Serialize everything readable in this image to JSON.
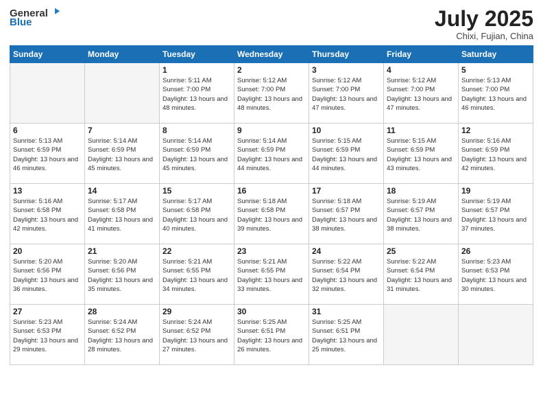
{
  "header": {
    "logo_general": "General",
    "logo_blue": "Blue",
    "month": "July 2025",
    "location": "Chixi, Fujian, China"
  },
  "weekdays": [
    "Sunday",
    "Monday",
    "Tuesday",
    "Wednesday",
    "Thursday",
    "Friday",
    "Saturday"
  ],
  "weeks": [
    [
      {
        "day": "",
        "info": ""
      },
      {
        "day": "",
        "info": ""
      },
      {
        "day": "1",
        "info": "Sunrise: 5:11 AM\nSunset: 7:00 PM\nDaylight: 13 hours and 48 minutes."
      },
      {
        "day": "2",
        "info": "Sunrise: 5:12 AM\nSunset: 7:00 PM\nDaylight: 13 hours and 48 minutes."
      },
      {
        "day": "3",
        "info": "Sunrise: 5:12 AM\nSunset: 7:00 PM\nDaylight: 13 hours and 47 minutes."
      },
      {
        "day": "4",
        "info": "Sunrise: 5:12 AM\nSunset: 7:00 PM\nDaylight: 13 hours and 47 minutes."
      },
      {
        "day": "5",
        "info": "Sunrise: 5:13 AM\nSunset: 7:00 PM\nDaylight: 13 hours and 46 minutes."
      }
    ],
    [
      {
        "day": "6",
        "info": "Sunrise: 5:13 AM\nSunset: 6:59 PM\nDaylight: 13 hours and 46 minutes."
      },
      {
        "day": "7",
        "info": "Sunrise: 5:14 AM\nSunset: 6:59 PM\nDaylight: 13 hours and 45 minutes."
      },
      {
        "day": "8",
        "info": "Sunrise: 5:14 AM\nSunset: 6:59 PM\nDaylight: 13 hours and 45 minutes."
      },
      {
        "day": "9",
        "info": "Sunrise: 5:14 AM\nSunset: 6:59 PM\nDaylight: 13 hours and 44 minutes."
      },
      {
        "day": "10",
        "info": "Sunrise: 5:15 AM\nSunset: 6:59 PM\nDaylight: 13 hours and 44 minutes."
      },
      {
        "day": "11",
        "info": "Sunrise: 5:15 AM\nSunset: 6:59 PM\nDaylight: 13 hours and 43 minutes."
      },
      {
        "day": "12",
        "info": "Sunrise: 5:16 AM\nSunset: 6:59 PM\nDaylight: 13 hours and 42 minutes."
      }
    ],
    [
      {
        "day": "13",
        "info": "Sunrise: 5:16 AM\nSunset: 6:58 PM\nDaylight: 13 hours and 42 minutes."
      },
      {
        "day": "14",
        "info": "Sunrise: 5:17 AM\nSunset: 6:58 PM\nDaylight: 13 hours and 41 minutes."
      },
      {
        "day": "15",
        "info": "Sunrise: 5:17 AM\nSunset: 6:58 PM\nDaylight: 13 hours and 40 minutes."
      },
      {
        "day": "16",
        "info": "Sunrise: 5:18 AM\nSunset: 6:58 PM\nDaylight: 13 hours and 39 minutes."
      },
      {
        "day": "17",
        "info": "Sunrise: 5:18 AM\nSunset: 6:57 PM\nDaylight: 13 hours and 38 minutes."
      },
      {
        "day": "18",
        "info": "Sunrise: 5:19 AM\nSunset: 6:57 PM\nDaylight: 13 hours and 38 minutes."
      },
      {
        "day": "19",
        "info": "Sunrise: 5:19 AM\nSunset: 6:57 PM\nDaylight: 13 hours and 37 minutes."
      }
    ],
    [
      {
        "day": "20",
        "info": "Sunrise: 5:20 AM\nSunset: 6:56 PM\nDaylight: 13 hours and 36 minutes."
      },
      {
        "day": "21",
        "info": "Sunrise: 5:20 AM\nSunset: 6:56 PM\nDaylight: 13 hours and 35 minutes."
      },
      {
        "day": "22",
        "info": "Sunrise: 5:21 AM\nSunset: 6:55 PM\nDaylight: 13 hours and 34 minutes."
      },
      {
        "day": "23",
        "info": "Sunrise: 5:21 AM\nSunset: 6:55 PM\nDaylight: 13 hours and 33 minutes."
      },
      {
        "day": "24",
        "info": "Sunrise: 5:22 AM\nSunset: 6:54 PM\nDaylight: 13 hours and 32 minutes."
      },
      {
        "day": "25",
        "info": "Sunrise: 5:22 AM\nSunset: 6:54 PM\nDaylight: 13 hours and 31 minutes."
      },
      {
        "day": "26",
        "info": "Sunrise: 5:23 AM\nSunset: 6:53 PM\nDaylight: 13 hours and 30 minutes."
      }
    ],
    [
      {
        "day": "27",
        "info": "Sunrise: 5:23 AM\nSunset: 6:53 PM\nDaylight: 13 hours and 29 minutes."
      },
      {
        "day": "28",
        "info": "Sunrise: 5:24 AM\nSunset: 6:52 PM\nDaylight: 13 hours and 28 minutes."
      },
      {
        "day": "29",
        "info": "Sunrise: 5:24 AM\nSunset: 6:52 PM\nDaylight: 13 hours and 27 minutes."
      },
      {
        "day": "30",
        "info": "Sunrise: 5:25 AM\nSunset: 6:51 PM\nDaylight: 13 hours and 26 minutes."
      },
      {
        "day": "31",
        "info": "Sunrise: 5:25 AM\nSunset: 6:51 PM\nDaylight: 13 hours and 25 minutes."
      },
      {
        "day": "",
        "info": ""
      },
      {
        "day": "",
        "info": ""
      }
    ]
  ]
}
